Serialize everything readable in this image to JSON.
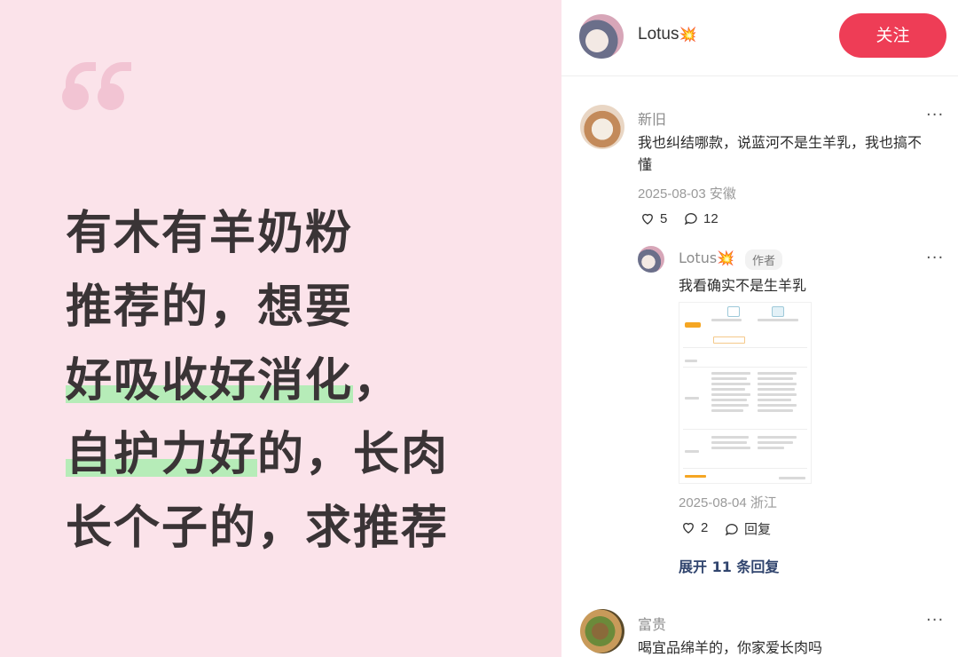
{
  "post": {
    "headline_lines": [
      [
        "有木有羊奶粉"
      ],
      [
        "推荐的，想要"
      ],
      [
        "好吸收好消化",
        "，"
      ],
      [
        "自护力好",
        "的，长肉"
      ],
      [
        "长个子的，求推荐"
      ]
    ]
  },
  "author": {
    "name": "Lotus",
    "badge": "💥",
    "follow_label": "关注"
  },
  "comments": [
    {
      "user": "新旧",
      "text_line1": "我也纠结哪款，说蓝河不是生羊乳，我也搞不",
      "text_line2": "懂",
      "meta": "2025-08-03 安徽",
      "likes": "5",
      "replies": "12",
      "more": "···"
    },
    {
      "reply_user": "Lotus",
      "reply_badge": "💥",
      "author_tag": "作者",
      "reply_text": "我看确实不是生羊乳",
      "reply_meta": "2025-08-04 浙江",
      "reply_likes": "2",
      "reply_label": "回复",
      "expand_label": "展开 11 条回复",
      "more": "···"
    },
    {
      "user": "富贵",
      "text": "喝宜品绵羊的，你家爱长肉吗",
      "more": "···"
    }
  ],
  "icons": [
    "heart-icon",
    "comment-icon",
    "more-icon"
  ],
  "colors": {
    "card_bg": "#fbe3ea",
    "highlight": "#b6ecb8",
    "follow_bg": "#ee3d56",
    "quote": "#f2c4d3",
    "expand": "#31456e"
  }
}
